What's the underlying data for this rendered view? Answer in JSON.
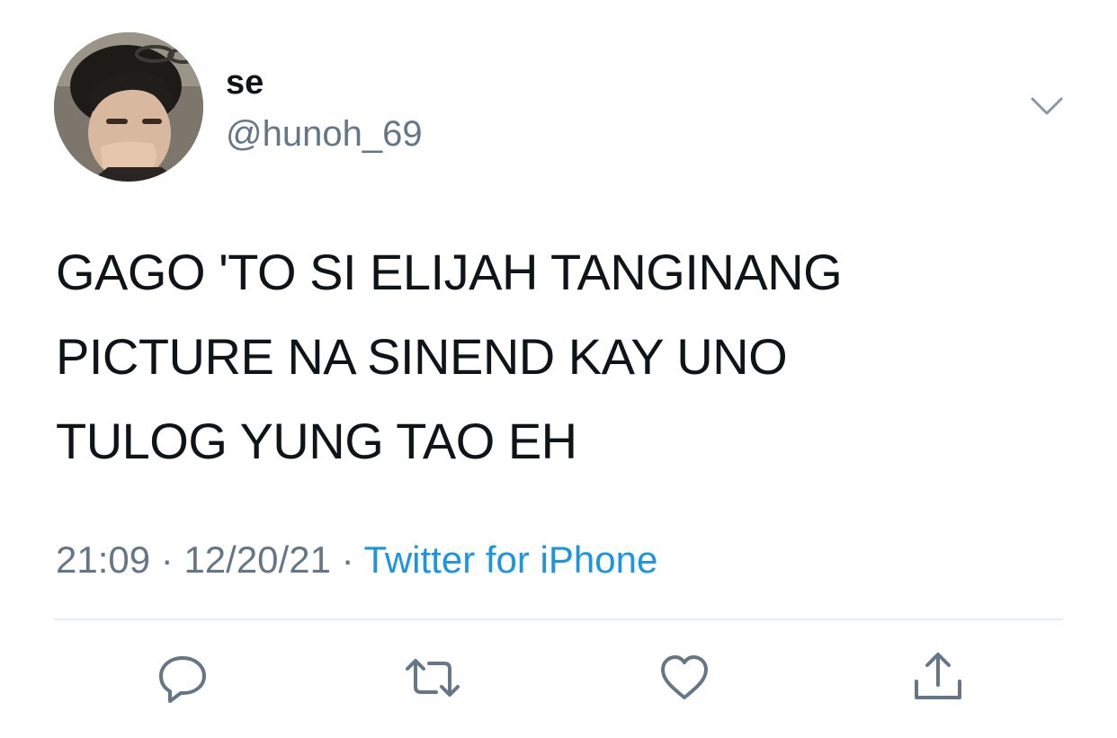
{
  "user": {
    "display_name": "se",
    "handle": "@hunoh_69",
    "avatar_icon": "profile-photo"
  },
  "header": {
    "menu_icon": "chevron-down-icon"
  },
  "tweet": {
    "lines": [
      "GAGO 'TO SI ELIJAH TANGINANG",
      "PICTURE NA SINEND KAY UNO",
      "TULOG YUNG TAO EH"
    ]
  },
  "meta": {
    "time": "21:09",
    "separator": " · ",
    "date": "12/20/21",
    "source": "Twitter for iPhone"
  },
  "actions": [
    {
      "name": "reply",
      "icon": "reply-icon"
    },
    {
      "name": "retweet",
      "icon": "retweet-icon"
    },
    {
      "name": "like",
      "icon": "heart-icon"
    },
    {
      "name": "share",
      "icon": "share-icon"
    }
  ],
  "colors": {
    "text": "#0f1419",
    "secondary": "#657786",
    "link": "#1b95e0",
    "icon": "#657786",
    "divider": "#e6ecf0"
  }
}
